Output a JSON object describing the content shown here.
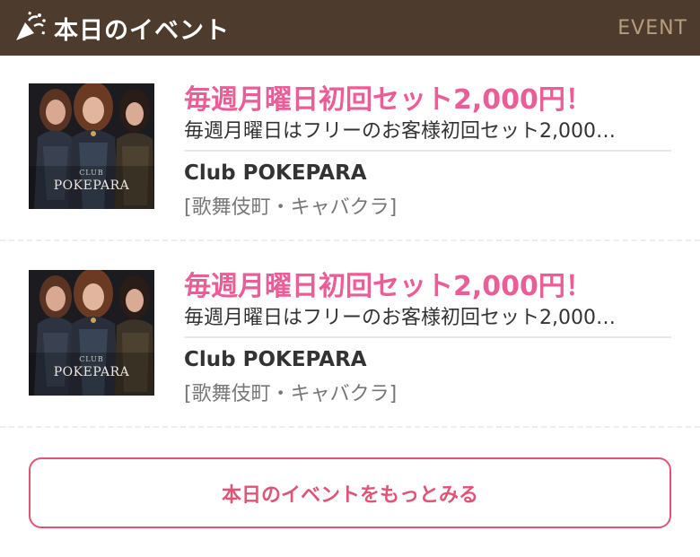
{
  "header": {
    "title": "本日のイベント",
    "subtitle": "EVENT",
    "icon": "party-popper-icon"
  },
  "events": [
    {
      "title": "毎週月曜日初回セット2,000円！",
      "description": "毎週月曜日はフリーのお客様初回セット2,000…",
      "club_name": "Club POKEPARA",
      "genre": "[歌舞伎町・キャバクラ]",
      "thumb_label_small": "CLUB",
      "thumb_label": "POKEPARA"
    },
    {
      "title": "毎週月曜日初回セット2,000円！",
      "description": "毎週月曜日はフリーのお客様初回セット2,000…",
      "club_name": "Club POKEPARA",
      "genre": "[歌舞伎町・キャバクラ]",
      "thumb_label_small": "CLUB",
      "thumb_label": "POKEPARA"
    }
  ],
  "more_button": {
    "label": "本日のイベントをもっとみる"
  },
  "colors": {
    "header_bg": "#4d3c2e",
    "header_sub": "#b59e7e",
    "accent_pink": "#ea5d96",
    "button_border": "#e05577"
  }
}
